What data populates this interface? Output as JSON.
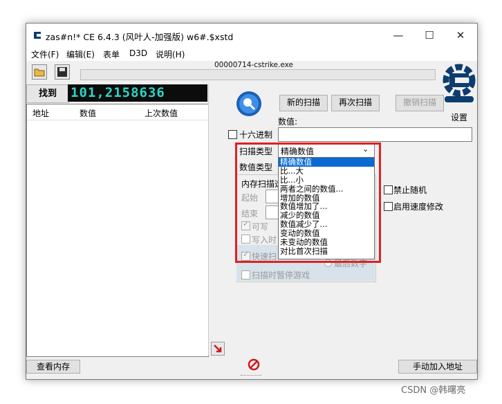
{
  "window": {
    "title": "zas#n!*  CE 6.4.3 (风叶人-加强版)  w6#.$xstd",
    "process": "00000714-cstrike.exe"
  },
  "menu": [
    "文件(F)",
    "编辑(E)",
    "表单",
    "D3D",
    "说明(H)"
  ],
  "found": {
    "label": "找到",
    "counter": "101,2158636"
  },
  "results_columns": [
    "地址",
    "数值",
    "上次数值"
  ],
  "buttons": {
    "new_scan": "新的扫描",
    "next_scan": "再次扫描",
    "undo_scan": "撤销扫描",
    "settings": "设置",
    "view_memory": "查看内存",
    "add_address": "手动加入地址"
  },
  "value_label": "数值:",
  "hex_label": "十六进制",
  "scan_type": {
    "label": "扫描类型",
    "selected": "精确数值",
    "options": [
      "精确数值",
      "比...大",
      "比...小",
      "两者之间的数值...",
      "增加的数值",
      "数值增加了...",
      "减少的数值",
      "数值减少了...",
      "变动的数值",
      "未变动的数值",
      "对比首次扫描"
    ]
  },
  "value_type_label": "数值类型",
  "memory_options": {
    "group_label": "内存扫描选",
    "start": "起始",
    "end": "结束",
    "writable": "可写",
    "copy_on_write": "写入时",
    "fast_scan": "快速扫",
    "last_digit": "最后数字",
    "pause_game": "扫描时暂停游戏"
  },
  "right_options": {
    "no_random": "禁止随机",
    "speedhack": "启用速度修改"
  },
  "logo_text": "Cheat Engine",
  "watermark": "CSDN @韩曙亮",
  "colors": {
    "highlight": "#0a6ad1",
    "red_frame": "#e02020",
    "counter": "#2bd6c6"
  }
}
